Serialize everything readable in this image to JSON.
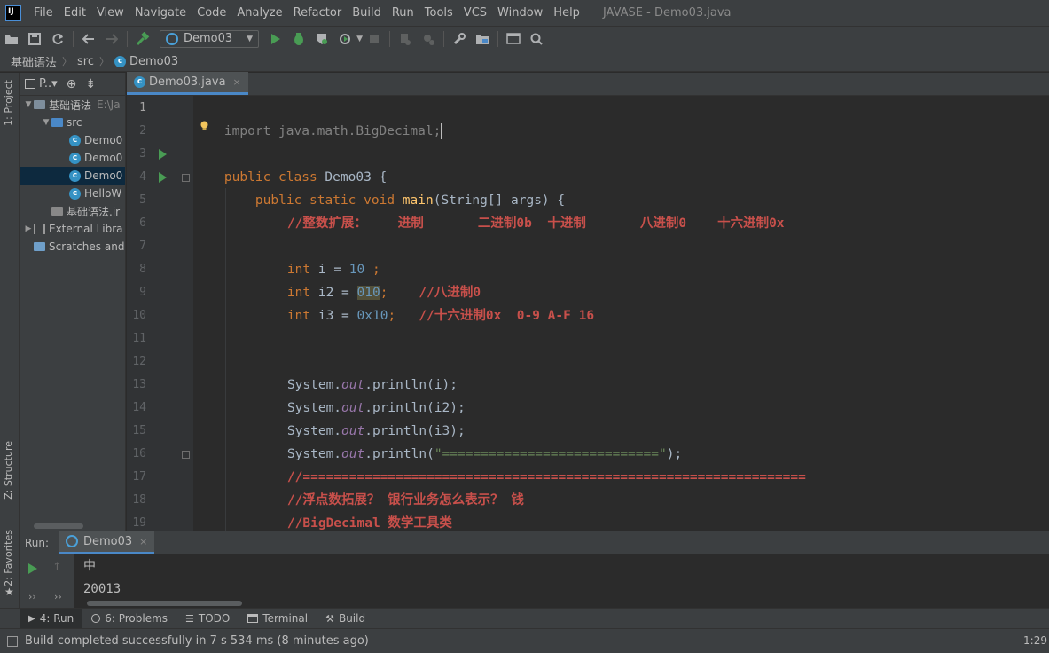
{
  "menubar": {
    "logo": "IJ",
    "items": [
      "File",
      "Edit",
      "View",
      "Navigate",
      "Code",
      "Analyze",
      "Refactor",
      "Build",
      "Run",
      "Tools",
      "VCS",
      "Window",
      "Help"
    ],
    "window_title": "JAVASE - Demo03.java"
  },
  "toolbar": {
    "run_config": "Demo03",
    "icons": [
      "open-icon",
      "save-icon",
      "sync-icon",
      "back-icon",
      "forward-icon",
      "build-hammer-icon",
      "run-icon",
      "debug-icon",
      "coverage-icon",
      "profile-icon",
      "stop-icon",
      "attach-icon",
      "settings-icon",
      "project-structure-icon",
      "terminal-icon",
      "search-icon"
    ]
  },
  "breadcrumb": {
    "items": [
      "基础语法",
      "src",
      "Demo03"
    ]
  },
  "side_tabs": {
    "project": "1: Project",
    "structure": "Z: Structure",
    "favorites": "2: Favorites"
  },
  "project_panel": {
    "title": "P..▾",
    "tree": [
      {
        "label": "基础语法",
        "suffix": "E:\\Ja",
        "type": "folder",
        "level": 0
      },
      {
        "label": "src",
        "type": "src-folder",
        "level": 1
      },
      {
        "label": "Demo0",
        "type": "class",
        "level": 2
      },
      {
        "label": "Demo0",
        "type": "class",
        "level": 2
      },
      {
        "label": "Demo0",
        "type": "class",
        "level": 2,
        "selected": true
      },
      {
        "label": "HelloW",
        "type": "class",
        "level": 2
      },
      {
        "label": "基础语法.ir",
        "type": "iml",
        "level": 1
      },
      {
        "label": "External Libra",
        "type": "library",
        "level": 0
      },
      {
        "label": "Scratches and",
        "type": "scratch",
        "level": 0
      }
    ]
  },
  "editor": {
    "tab_label": "Demo03.java",
    "tab_close": "×",
    "line_numbers": [
      "1",
      "2",
      "3",
      "4",
      "5",
      "6",
      "7",
      "8",
      "9",
      "10",
      "11",
      "12",
      "13",
      "14",
      "15",
      "16",
      "17",
      "18",
      "19"
    ],
    "code": {
      "l1_import": "import java.math.BigDecimal;",
      "l3_public": "public class ",
      "l3_name": "Demo03 {",
      "l4_mods": "public static void ",
      "l4_main": "main",
      "l4_params": "(String[] args) {",
      "l5_comment": "//整数扩展：    进制       二进制0b  十进制       八进制0    十六进制0x",
      "l7_type": "int",
      "l7_var": " i = ",
      "l7_val": "10",
      "l7_end": " ;",
      "l8_type": "int",
      "l8_var": " i2 = ",
      "l8_val": "010",
      "l8_end": ";",
      "l8_comment": "//八进制0",
      "l9_type": "int",
      "l9_var": " i3 = ",
      "l9_val": "0x10",
      "l9_end": ";",
      "l9_comment": "//十六进制0x  0-9 A-F 16",
      "sys": "System.",
      "out": "out",
      "l12_rest": ".println(i);",
      "l13_rest": ".println(i2);",
      "l14_rest": ".println(i3);",
      "l15_mid": ".println(",
      "l15_str": "\"============================\"",
      "l15_end": ");",
      "l16_comment": "//=================================================================",
      "l17_comment": "//浮点数拓展？ 银行业务怎么表示？ 钱",
      "l18_comment": "//BigDecimal 数学工具类",
      "l19_comment": "//================================================================="
    }
  },
  "run_panel": {
    "label": "Run:",
    "tab": "Demo03",
    "tab_close": "×",
    "output": [
      "中",
      "20013"
    ]
  },
  "bottom_tabs": [
    {
      "label": "4: Run",
      "icon": "run-icon"
    },
    {
      "label": "6: Problems",
      "icon": "problems-icon"
    },
    {
      "label": "TODO",
      "icon": "todo-icon"
    },
    {
      "label": "Terminal",
      "icon": "terminal-icon"
    },
    {
      "label": "Build",
      "icon": "build-icon"
    }
  ],
  "statusbar": {
    "message": "Build completed successfully in 7 s 534 ms (8 minutes ago)",
    "position": "1:29"
  },
  "colors": {
    "keyword": "#cc7832",
    "string": "#6a8759",
    "number": "#6897bb",
    "comment": "#c8504b",
    "method": "#ffc66d",
    "field": "#9876aa",
    "accent": "#4a88c7"
  }
}
